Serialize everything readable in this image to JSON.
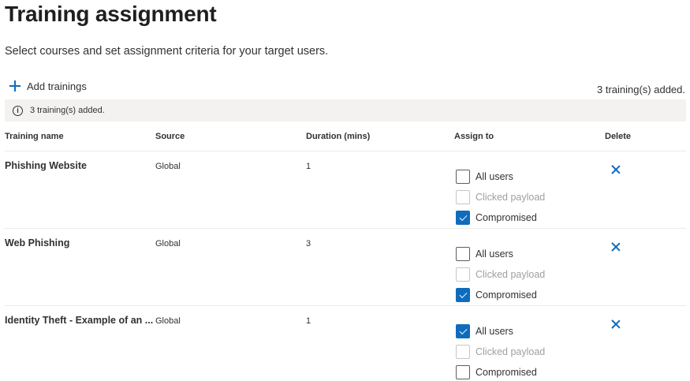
{
  "page": {
    "title": "Training assignment",
    "subtitle": "Select courses and set assignment criteria for your target users."
  },
  "toolbar": {
    "add_label": "Add trainings",
    "count_text": "3 training(s) added."
  },
  "info_bar": {
    "icon": "info-icon",
    "text": "3 training(s) added."
  },
  "table": {
    "columns": [
      "Training name",
      "Source",
      "Duration (mins)",
      "Assign to",
      "Delete"
    ],
    "rows": [
      {
        "name": "Phishing Website",
        "source": "Global",
        "duration": "1",
        "assign": [
          {
            "label": "All users",
            "checked": false,
            "disabled": false
          },
          {
            "label": "Clicked payload",
            "checked": false,
            "disabled": true
          },
          {
            "label": "Compromised",
            "checked": true,
            "disabled": false
          }
        ]
      },
      {
        "name": "Web Phishing",
        "source": "Global",
        "duration": "3",
        "assign": [
          {
            "label": "All users",
            "checked": false,
            "disabled": false
          },
          {
            "label": "Clicked payload",
            "checked": false,
            "disabled": true
          },
          {
            "label": "Compromised",
            "checked": true,
            "disabled": false
          }
        ]
      },
      {
        "name": "Identity Theft - Example of an ...",
        "source": "Global",
        "duration": "1",
        "assign": [
          {
            "label": "All users",
            "checked": true,
            "disabled": false
          },
          {
            "label": "Clicked payload",
            "checked": false,
            "disabled": true
          },
          {
            "label": "Compromised",
            "checked": false,
            "disabled": false
          }
        ]
      }
    ]
  },
  "colors": {
    "accent": "#0f6cbd",
    "info_bar_bg": "#f3f2f1",
    "disabled_text": "#a19f9d"
  }
}
